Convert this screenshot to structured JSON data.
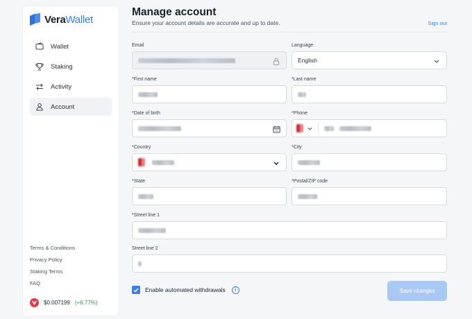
{
  "brand": {
    "name_bold": "Vera",
    "name_light": "Wallet"
  },
  "sidebar": {
    "items": [
      {
        "label": "Wallet",
        "icon": "wallet-icon",
        "active": false
      },
      {
        "label": "Staking",
        "icon": "trophy-icon",
        "active": false
      },
      {
        "label": "Activity",
        "icon": "arrows-swap-icon",
        "active": false
      },
      {
        "label": "Account",
        "icon": "user-icon",
        "active": true
      }
    ],
    "links": [
      "Terms & Conditions",
      "Privacy Policy",
      "Staking Terms",
      "FAQ"
    ],
    "price": {
      "value": "$0.007199",
      "change": "(+6.77%)"
    }
  },
  "page": {
    "title": "Manage account",
    "subtitle": "Ensure your account details are accurate and up to date.",
    "sign_out": "Sign out"
  },
  "form": {
    "email_label": "Email",
    "language_label": "Language",
    "language_value": "English",
    "first_name_label": "*First name",
    "last_name_label": "*Last name",
    "dob_label": "*Date of birth",
    "phone_label": "*Phone",
    "country_label": "*Country",
    "city_label": "*City",
    "state_label": "*State",
    "postal_label": "*Postal/ZIP code",
    "street1_label": "*Street line 1",
    "street2_label": "Street line 2",
    "checkbox_label": "Enable automated withdrawals",
    "checkbox_checked": true,
    "save_label": "Save changes"
  },
  "colors": {
    "accent": "#3d7fe0",
    "save_disabled": "#a9c8f4",
    "positive": "#1f9d55"
  }
}
